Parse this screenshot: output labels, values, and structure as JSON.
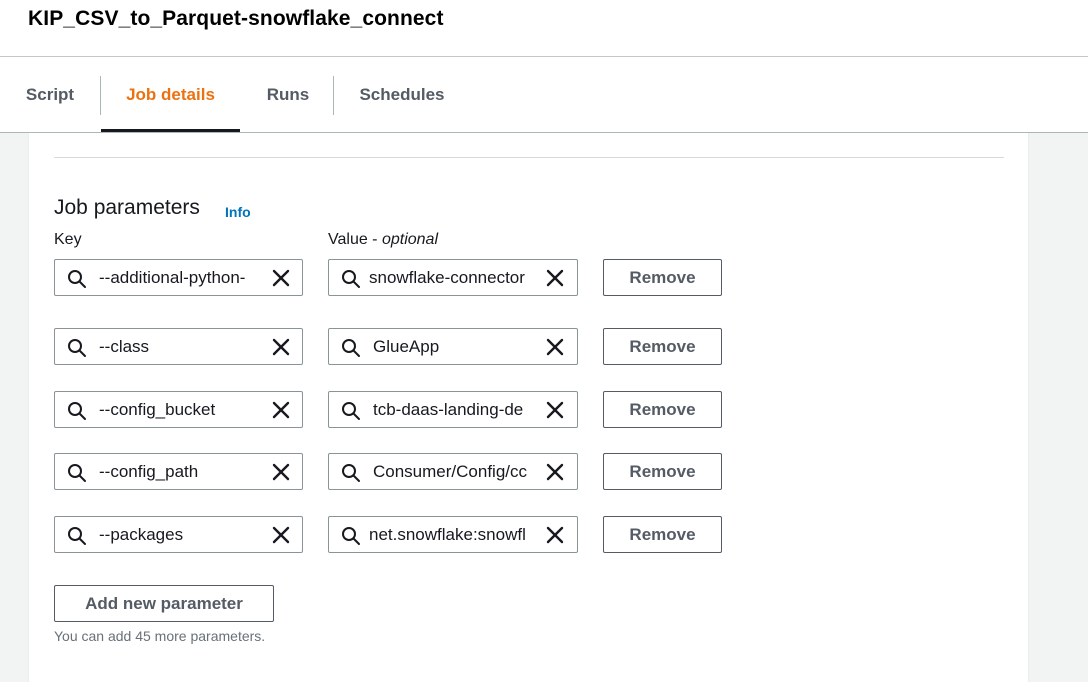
{
  "header": {
    "title": "KIP_CSV_to_Parquet-snowflake_connect"
  },
  "tabs": [
    {
      "label": "Script",
      "active": false
    },
    {
      "label": "Job details",
      "active": true
    },
    {
      "label": "Runs",
      "active": false
    },
    {
      "label": "Schedules",
      "active": false
    }
  ],
  "job_parameters": {
    "title": "Job parameters",
    "info_link": "Info",
    "key_label": "Key",
    "value_label": "Value - ",
    "value_label_optional": "optional",
    "rows": [
      {
        "key": "--additional-python-",
        "value": "snowflake-connector",
        "remove_label": "Remove"
      },
      {
        "key": "--class",
        "value": "GlueApp",
        "remove_label": "Remove"
      },
      {
        "key": "--config_bucket",
        "value": "tcb-daas-landing-de",
        "remove_label": "Remove"
      },
      {
        "key": "--config_path",
        "value": "Consumer/Config/cc",
        "remove_label": "Remove"
      },
      {
        "key": "--packages",
        "value": "net.snowflake:snowfl",
        "remove_label": "Remove"
      }
    ],
    "add_button": "Add new parameter",
    "hint": "You can add 45 more parameters."
  },
  "icons": {
    "search": "search-icon",
    "clear": "close-icon"
  },
  "colors": {
    "accent_tab": "#ec7211",
    "link": "#0073bb",
    "button_border": "#545b64",
    "input_border": "#879596"
  }
}
